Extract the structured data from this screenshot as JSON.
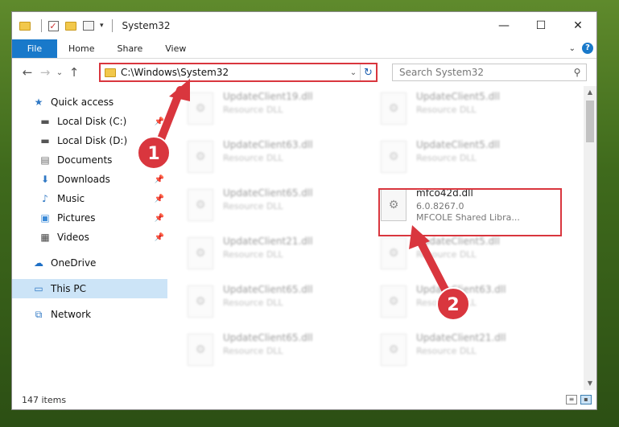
{
  "window": {
    "title": "System32",
    "controls": {
      "minimize": "—",
      "maximize": "☐",
      "close": "✕"
    }
  },
  "ribbon": {
    "file": "File",
    "tabs": [
      "Home",
      "Share",
      "View"
    ],
    "help": "?"
  },
  "address": {
    "path": "C:\\Windows\\System32"
  },
  "search": {
    "placeholder": "Search System32"
  },
  "sidebar": {
    "quick_access": "Quick access",
    "items": [
      {
        "label": "Local Disk (C:)",
        "icon": "drive-icon",
        "pinned": true
      },
      {
        "label": "Local Disk (D:)",
        "icon": "drive-icon",
        "pinned": false
      },
      {
        "label": "Documents",
        "icon": "documents-icon",
        "pinned": false
      },
      {
        "label": "Downloads",
        "icon": "downloads-icon",
        "pinned": true
      },
      {
        "label": "Music",
        "icon": "music-icon",
        "pinned": true
      },
      {
        "label": "Pictures",
        "icon": "pictures-icon",
        "pinned": true
      },
      {
        "label": "Videos",
        "icon": "videos-icon",
        "pinned": true
      }
    ],
    "onedrive": "OneDrive",
    "this_pc": "This PC",
    "network": "Network"
  },
  "files": {
    "left": [
      {
        "name": "UpdateClient19.dll",
        "type": "Resource DLL"
      },
      {
        "name": "UpdateClient63.dll",
        "type": "Resource DLL"
      },
      {
        "name": "UpdateClient65.dll",
        "type": "Resource DLL"
      },
      {
        "name": "UpdateClient21.dll",
        "type": "Resource DLL"
      },
      {
        "name": "UpdateClient65.dll",
        "type": "Resource DLL"
      },
      {
        "name": "UpdateClient65.dll",
        "type": "Resource DLL"
      }
    ],
    "right": [
      {
        "name": "UpdateClient5.dll",
        "type": "Resource DLL"
      },
      {
        "name": "UpdateClient5.dll",
        "type": "Resource DLL"
      },
      {
        "name": "mfco42d.dll",
        "version": "6.0.8267.0",
        "type": "MFCOLE Shared Libra...",
        "highlighted": true
      },
      {
        "name": "UpdateClient5.dll",
        "type": "Resource DLL"
      },
      {
        "name": "UpdateClient63.dll",
        "type": "Resource DLL"
      },
      {
        "name": "UpdateClient21.dll",
        "type": "Resource DLL"
      }
    ]
  },
  "status": {
    "items": "147 items"
  },
  "annotations": {
    "step1": "1",
    "step2": "2",
    "color": "#d9363e"
  }
}
